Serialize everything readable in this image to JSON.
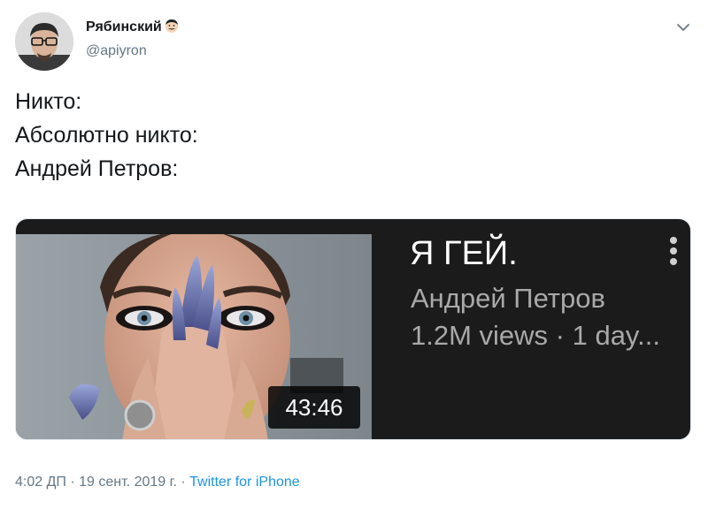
{
  "author": {
    "name": "Рябинский",
    "handle": "@apiyron",
    "name_emoji": "man-with-mustache-emoji"
  },
  "tweet_text": {
    "line1": "Никто:",
    "line2": "Абсолютно никто:",
    "line3": "Андрей Петров:"
  },
  "video_card": {
    "title": "Я ГЕЙ.",
    "channel": "Андрей Петров",
    "meta": "1.2M views · 1 day...",
    "duration": "43:46"
  },
  "footer": {
    "time": "4:02 ДП",
    "separator1": " · ",
    "date": "19 сент. 2019 г.",
    "separator2": " · ",
    "source": "Twitter for iPhone"
  },
  "icons": {
    "menu": "chevron-down-icon",
    "video_options": "more-vertical-icon"
  },
  "colors": {
    "text_primary": "#14171a",
    "text_secondary": "#657786",
    "link": "#1b95e0",
    "card_background": "#1b1b1b",
    "card_title": "#ffffff",
    "card_meta": "#a9a9a9"
  }
}
